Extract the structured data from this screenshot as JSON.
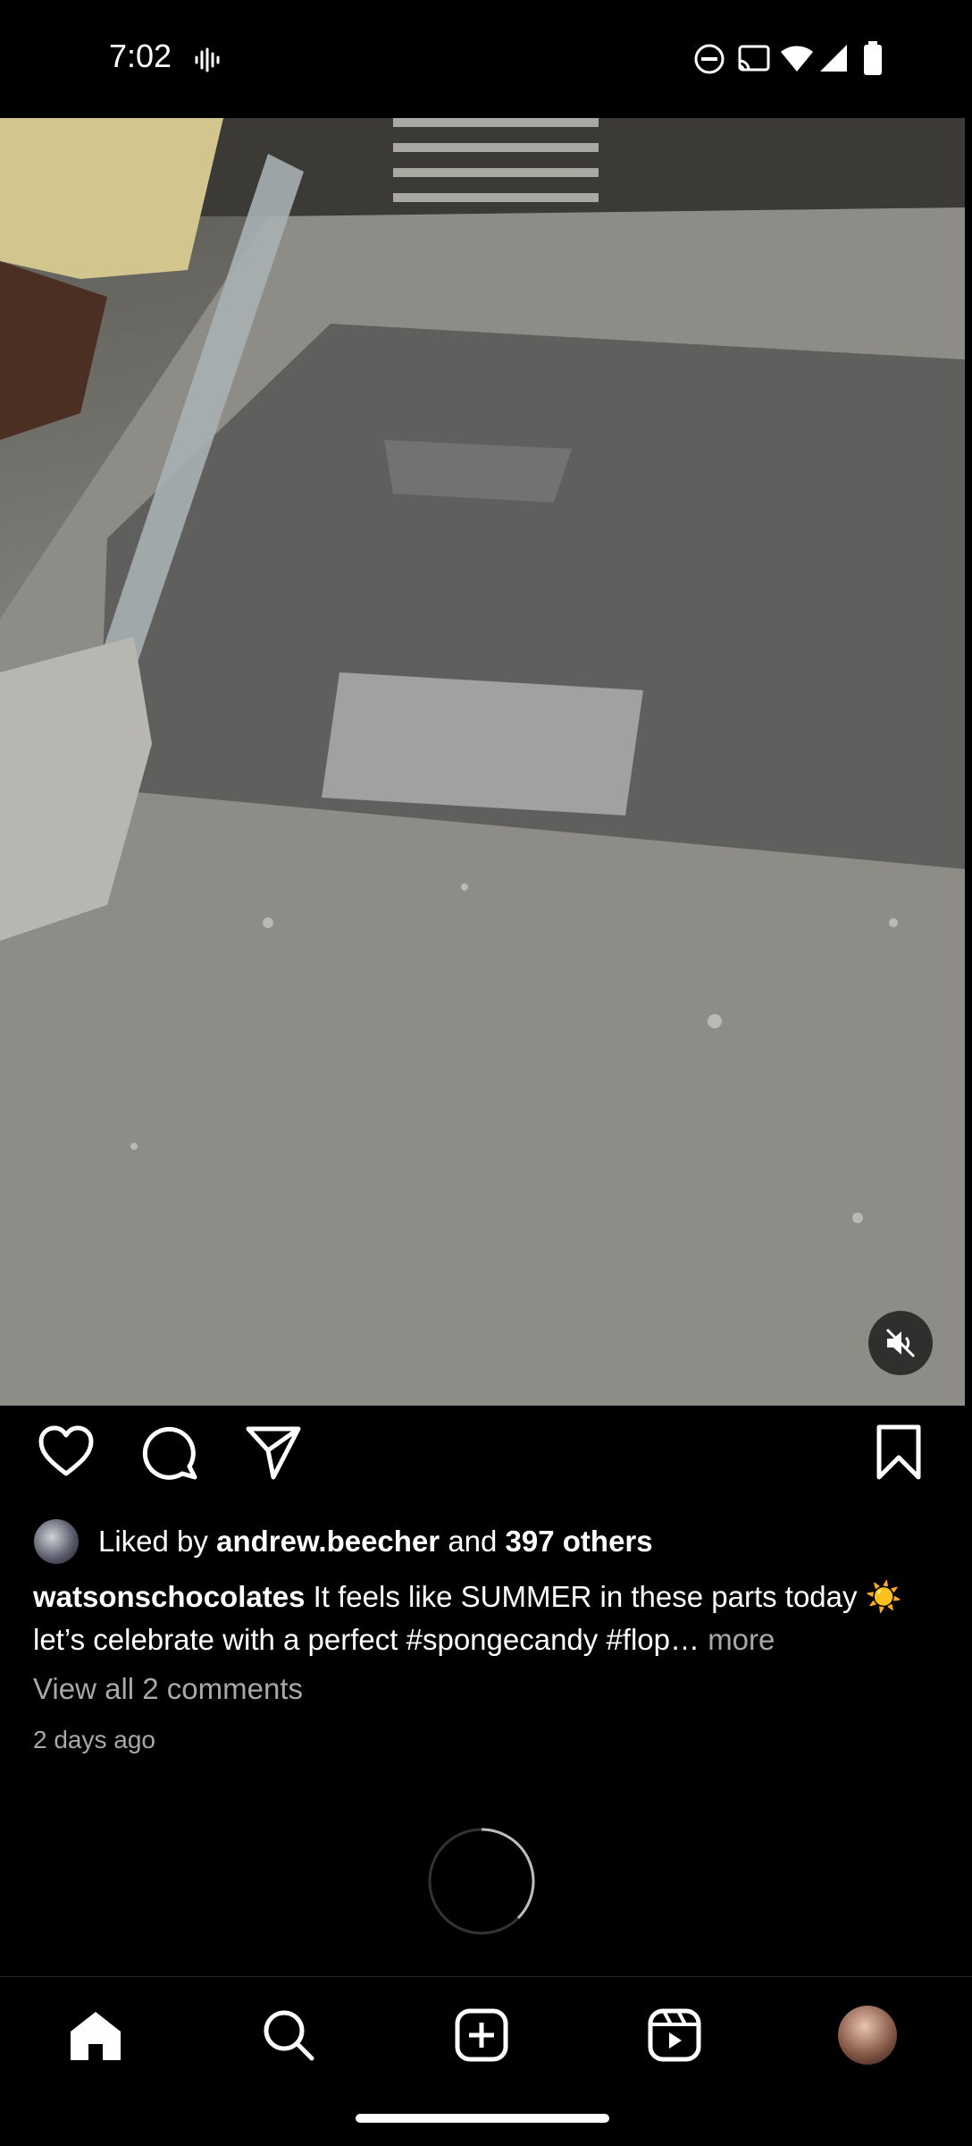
{
  "status_bar": {
    "time": "7:02",
    "icons": [
      "voice-wave-icon",
      "dnd-icon",
      "cast-icon",
      "wifi-icon",
      "signal-icon",
      "battery-icon"
    ]
  },
  "post": {
    "media": {
      "muted": true
    },
    "actions": [
      "heart-icon",
      "comment-icon",
      "share-icon",
      "bookmark-icon"
    ],
    "likes": {
      "prefix": "Liked by",
      "user": "andrew.beecher",
      "connector": "and",
      "others": "397 others"
    },
    "caption": {
      "username": "watsonschocolates",
      "text": "It feels like SUMMER in these parts today ☀️ let’s celebrate with a perfect #spongecandy #flop…",
      "more": "more"
    },
    "view_comments": "View all 2 comments",
    "time_ago": "2 days ago"
  },
  "bottom_nav": [
    "home-icon",
    "search-icon",
    "create-icon",
    "reels-icon",
    "profile-avatar"
  ]
}
